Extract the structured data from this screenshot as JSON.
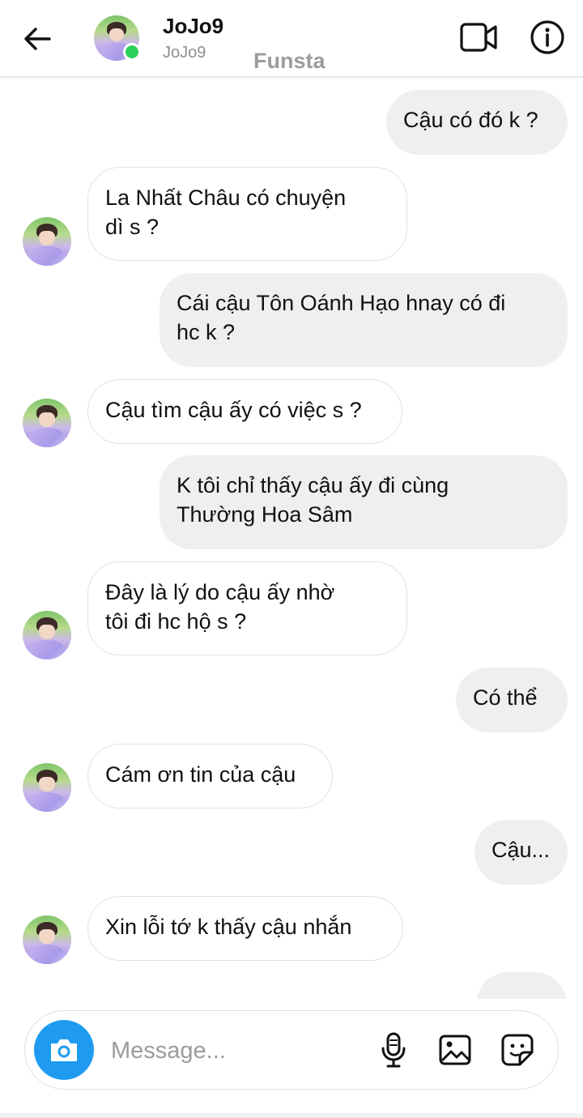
{
  "header": {
    "name": "JoJo9",
    "username": "JoJo9",
    "watermark": "Funsta"
  },
  "messages": [
    {
      "side": "sent",
      "text": "Cậu có đó k ?"
    },
    {
      "side": "received",
      "text": "La Nhất Châu có chuyện\ndì s ?"
    },
    {
      "side": "sent",
      "text": "Cái cậu Tôn Oánh Hạo hnay có đi\nhc k ?"
    },
    {
      "side": "received",
      "text": "Cậu tìm cậu ấy có việc s ?"
    },
    {
      "side": "sent",
      "text": "K tôi chỉ thấy cậu ấy đi cùng\nThường Hoa Sâm"
    },
    {
      "side": "received",
      "text": "Đây là lý do cậu ấy nhờ\ntôi đi hc hộ s ?"
    },
    {
      "side": "sent",
      "text": "Có thể"
    },
    {
      "side": "received",
      "text": "Cám ơn tin của cậu"
    },
    {
      "side": "sent",
      "text": "Cậu..."
    },
    {
      "side": "received",
      "text": "Xin lỗi tớ k thấy cậu nhắn"
    }
  ],
  "composer": {
    "placeholder": "Message..."
  },
  "icons": {
    "back": "arrow-left-icon",
    "video": "video-camera-icon",
    "info": "info-icon",
    "camera": "camera-icon",
    "mic": "microphone-icon",
    "gallery": "image-icon",
    "sticker": "sticker-icon"
  },
  "colors": {
    "accent": "#1e9bf0",
    "online": "#2bd05a",
    "sent_bubble": "#efefef",
    "received_border": "#e2e2e2"
  }
}
